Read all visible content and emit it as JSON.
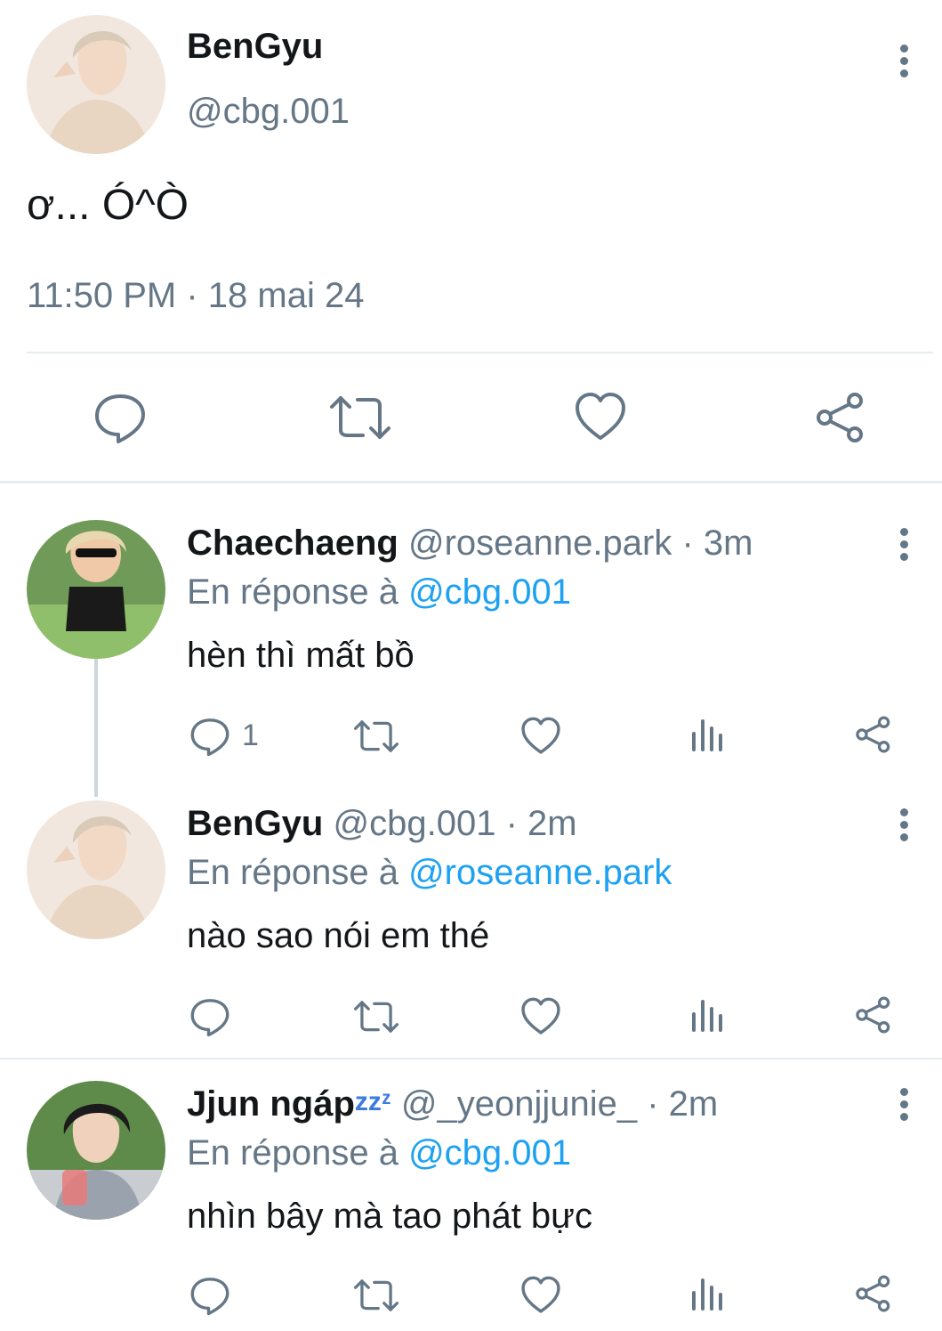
{
  "main_tweet": {
    "display_name": "BenGyu",
    "handle": "@cbg.001",
    "text": "ơ... Ó^Ò",
    "timestamp": "11:50 PM · 18 mai 24",
    "avatar_desc": "bengyu-avatar"
  },
  "replies": [
    {
      "display_name": "Chaechaeng",
      "handle": "@roseanne.park",
      "time": "· 3m",
      "reply_prefix": "En réponse à",
      "reply_to": "@cbg.001",
      "text": "hèn thì mất bồ",
      "reply_count": "1"
    },
    {
      "display_name": "BenGyu",
      "handle": "@cbg.001",
      "time": "· 2m",
      "reply_prefix": "En réponse à",
      "reply_to": "@roseanne.park",
      "text": "nào sao nói em thé",
      "reply_count": ""
    },
    {
      "display_name": "Jjun ngáp",
      "display_suffix": "zzᶻ",
      "handle": "@_yeonjjunie_",
      "time": "· 2m",
      "reply_prefix": "En réponse à",
      "reply_to": "@cbg.001",
      "text": "nhìn bây mà tao phát bực",
      "reply_count": ""
    }
  ],
  "icons": {
    "reply": "reply-icon",
    "retweet": "retweet-icon",
    "like": "heart-icon",
    "analytics": "analytics-icon",
    "share": "share-icon",
    "more": "more-icon"
  },
  "colors": {
    "text": "#14171a",
    "secondary": "#657786",
    "link": "#1da1f2",
    "divider": "#e6ecf0"
  }
}
